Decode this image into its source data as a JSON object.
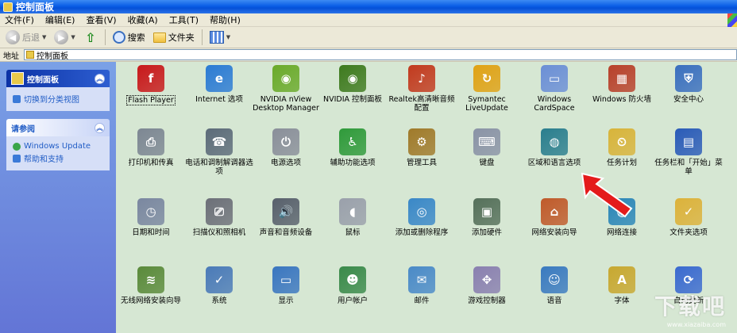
{
  "window": {
    "title": "控制面板"
  },
  "menu": [
    "文件(F)",
    "编辑(E)",
    "查看(V)",
    "收藏(A)",
    "工具(T)",
    "帮助(H)"
  ],
  "toolbar": {
    "back": "后退",
    "search": "搜索",
    "folders": "文件夹"
  },
  "address": {
    "label": "地址",
    "value": "控制面板"
  },
  "side": {
    "panel1": {
      "title": "控制面板",
      "link": "切换到分类视图"
    },
    "panel2": {
      "title": "请参阅",
      "links": [
        "Windows Update",
        "帮助和支持"
      ]
    }
  },
  "items": [
    {
      "label": "Flash Player",
      "icon": "flash-icon",
      "color": "#c8181a",
      "glyph": "f"
    },
    {
      "label": "Internet 选项",
      "icon": "globe-icon",
      "color": "#2b7bd4",
      "glyph": "e"
    },
    {
      "label": "NVIDIA nView Desktop Manager",
      "icon": "nvidia-icon",
      "color": "#6aaa2a",
      "glyph": "◉"
    },
    {
      "label": "NVIDIA 控制面板",
      "icon": "nvidia-panel-icon",
      "color": "#3e7a1e",
      "glyph": "◉"
    },
    {
      "label": "Realtek高清晰音频配置",
      "icon": "speaker-icon",
      "color": "#c23a1e",
      "glyph": "♪"
    },
    {
      "label": "Symantec LiveUpdate",
      "icon": "liveupdate-icon",
      "color": "#e0a214",
      "glyph": "↻"
    },
    {
      "label": "Windows CardSpace",
      "icon": "cardspace-icon",
      "color": "#6b8fd6",
      "glyph": "▭"
    },
    {
      "label": "Windows 防火墙",
      "icon": "firewall-icon",
      "color": "#b8402a",
      "glyph": "▦"
    },
    {
      "label": "安全中心",
      "icon": "shield-icon",
      "color": "#3a6fbf",
      "glyph": "⛨"
    },
    {
      "label": "打印机和传真",
      "icon": "printer-icon",
      "color": "#7d8793",
      "glyph": "⎙"
    },
    {
      "label": "电话和调制解调器选项",
      "icon": "phone-icon",
      "color": "#5c6b79",
      "glyph": "☎"
    },
    {
      "label": "电源选项",
      "icon": "power-icon",
      "color": "#8a8f9a",
      "glyph": "⏻"
    },
    {
      "label": "辅助功能选项",
      "icon": "accessibility-icon",
      "color": "#2f9a3a",
      "glyph": "♿"
    },
    {
      "label": "管理工具",
      "icon": "admin-tools-icon",
      "color": "#a07a2a",
      "glyph": "⚙"
    },
    {
      "label": "键盘",
      "icon": "keyboard-icon",
      "color": "#8a93a6",
      "glyph": "⌨"
    },
    {
      "label": "区域和语言选项",
      "icon": "globe-region-icon",
      "color": "#2a7e8e",
      "glyph": "◍"
    },
    {
      "label": "任务计划",
      "icon": "task-schedule-icon",
      "color": "#d8b43a",
      "glyph": "⏲"
    },
    {
      "label": "任务栏和「开始」菜单",
      "icon": "taskbar-icon",
      "color": "#2a5bb8",
      "glyph": "▤"
    },
    {
      "label": "日期和时间",
      "icon": "clock-icon",
      "color": "#7a87a0",
      "glyph": "◷"
    },
    {
      "label": "扫描仪和照相机",
      "icon": "scanner-icon",
      "color": "#6c6f78",
      "glyph": "⎚"
    },
    {
      "label": "声音和音频设备",
      "icon": "sound-icon",
      "color": "#58606c",
      "glyph": "🔊"
    },
    {
      "label": "鼠标",
      "icon": "mouse-icon",
      "color": "#9aa0ab",
      "glyph": "◖"
    },
    {
      "label": "添加或删除程序",
      "icon": "add-remove-icon",
      "color": "#3a88c8",
      "glyph": "◎"
    },
    {
      "label": "添加硬件",
      "icon": "add-hardware-icon",
      "color": "#55705a",
      "glyph": "▣"
    },
    {
      "label": "网络安装向导",
      "icon": "network-wizard-icon",
      "color": "#c05a2a",
      "glyph": "⌂"
    },
    {
      "label": "网络连接",
      "icon": "network-icon",
      "color": "#2a86b8",
      "glyph": "◍"
    },
    {
      "label": "文件夹选项",
      "icon": "folder-options-icon",
      "color": "#dcb23a",
      "glyph": "✓"
    },
    {
      "label": "无线网络安装向导",
      "icon": "wireless-icon",
      "color": "#5a8a3a",
      "glyph": "≋"
    },
    {
      "label": "系统",
      "icon": "system-icon",
      "color": "#4a7ab8",
      "glyph": "✓"
    },
    {
      "label": "显示",
      "icon": "display-icon",
      "color": "#3a76c0",
      "glyph": "▭"
    },
    {
      "label": "用户帐户",
      "icon": "users-icon",
      "color": "#3a8a4a",
      "glyph": "☻"
    },
    {
      "label": "邮件",
      "icon": "mail-icon",
      "color": "#4a8ac8",
      "glyph": "✉"
    },
    {
      "label": "游戏控制器",
      "icon": "gamepad-icon",
      "color": "#8a80b0",
      "glyph": "✥"
    },
    {
      "label": "语音",
      "icon": "speech-icon",
      "color": "#3a7ac0",
      "glyph": "☺"
    },
    {
      "label": "字体",
      "icon": "fonts-icon",
      "color": "#c8a830",
      "glyph": "A"
    },
    {
      "label": "自动更新",
      "icon": "auto-update-icon",
      "color": "#3a6ad0",
      "glyph": "⟳"
    }
  ],
  "watermark": {
    "main": "下载吧",
    "url": "www.xiazaiba.com"
  }
}
